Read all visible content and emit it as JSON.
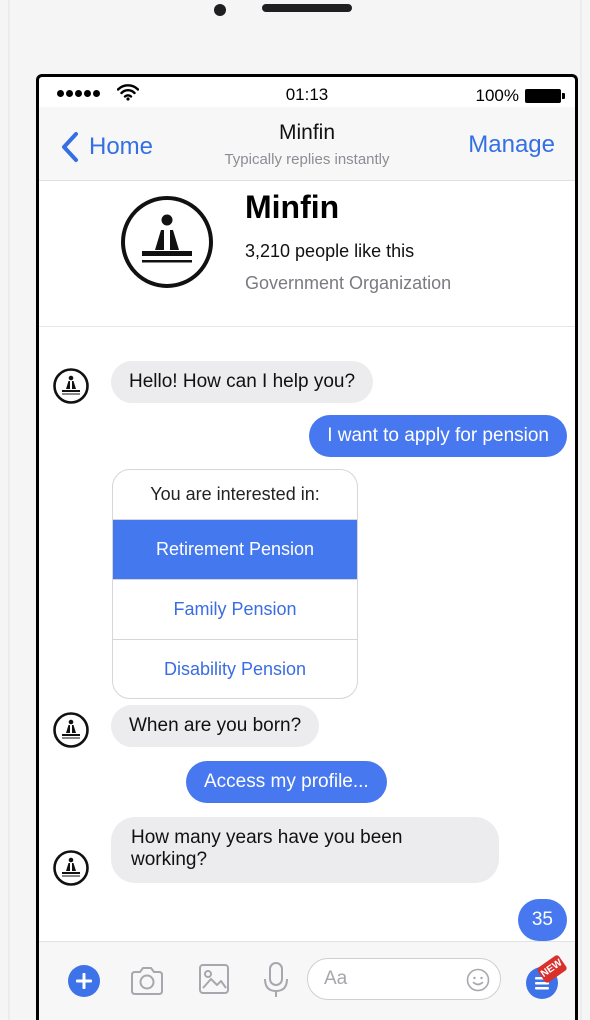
{
  "status_bar": {
    "time": "01:13",
    "battery": "100%"
  },
  "navbar": {
    "back_label": "Home",
    "title": "Minfin",
    "subtitle": "Typically replies instantly",
    "manage_label": "Manage"
  },
  "page_info": {
    "name": "Minfin",
    "likes": "3,210 people like this",
    "category": "Government Organization"
  },
  "messages": [
    {
      "from": "bot",
      "text": "Hello! How can I help you?"
    },
    {
      "from": "user",
      "text": "I want to apply for pension"
    },
    {
      "from": "bot",
      "type": "quick_replies",
      "prompt": "You are interested in:",
      "options": [
        "Retirement Pension",
        "Family Pension",
        "Disability Pension"
      ],
      "selected_option": "Retirement Pension"
    },
    {
      "from": "bot",
      "text": "When are you born?"
    },
    {
      "from": "user",
      "text": "Access my profile..."
    },
    {
      "from": "bot",
      "text": "How many years have you been working?"
    },
    {
      "from": "user",
      "text": "35"
    }
  ],
  "composer": {
    "placeholder": "Aa",
    "icons": [
      "plus-icon",
      "camera-icon",
      "image-icon",
      "microphone-icon",
      "emoji-icon",
      "menu-icon"
    ],
    "menu_badge": "NEW"
  },
  "colors": {
    "accent_blue": "#3470e3",
    "outgoing_bubble": "#4778ef",
    "incoming_bubble": "#ececee",
    "badge_red": "#d9302c"
  }
}
